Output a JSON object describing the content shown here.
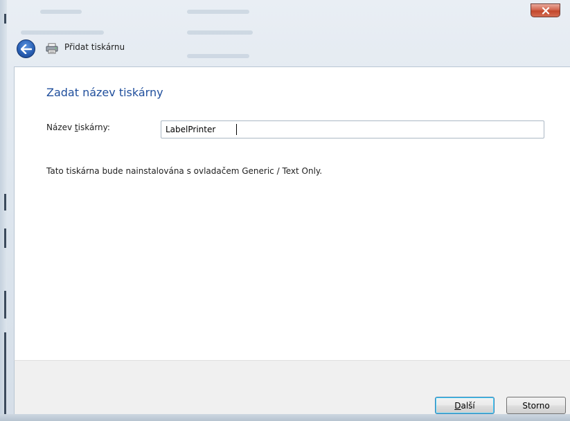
{
  "window": {
    "title": "Přidat tiskárnu",
    "close_label": "x"
  },
  "icons": {
    "back": "back-arrow-icon",
    "printer": "printer-icon",
    "close": "close-icon"
  },
  "page": {
    "heading": "Zadat název tiskárny",
    "name_label_prefix": "Název ",
    "name_label_mnemonic": "t",
    "name_label_suffix": "iskárny:",
    "name_value": "LabelPrinter",
    "driver_text": "Tato tiskárna bude nainstalována s ovladačem Generic / Text Only."
  },
  "footer": {
    "next_mnemonic": "D",
    "next_rest": "alší",
    "cancel_label": "Storno"
  },
  "colors": {
    "heading": "#1f4e9c",
    "close_button": "#c2472c",
    "default_button_border": "#3c7fb1"
  }
}
